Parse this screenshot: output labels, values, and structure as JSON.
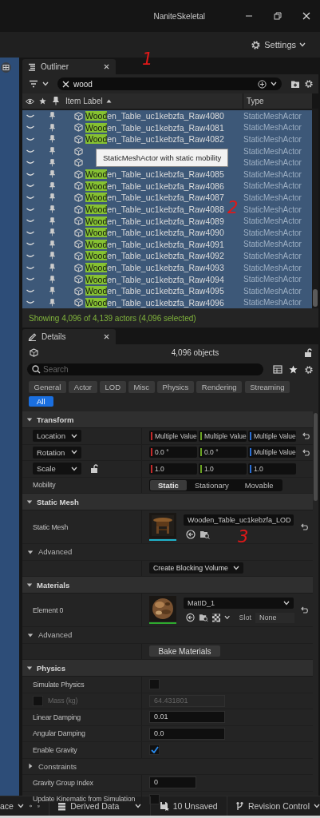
{
  "window": {
    "title": "NaniteSkeletal"
  },
  "toolbar": {
    "settings": "Settings"
  },
  "annotations": [
    "1",
    "2",
    "3"
  ],
  "outliner": {
    "tab": "Outliner",
    "search": {
      "value": "wood"
    },
    "columns": [
      "Item Label",
      "Type"
    ],
    "rows": [
      {
        "label": "**Wood**en_Table_uc1kebzfa_Raw4080",
        "type": "StaticMeshActor",
        "selected": true
      },
      {
        "label": "**Wood**en_Table_uc1kebzfa_Raw4081",
        "type": "StaticMeshActor",
        "selected": true
      },
      {
        "label": "**Wood**en_Table_uc1kebzfa_Raw4082",
        "type": "StaticMeshActor",
        "selected": true
      },
      {
        "type": "StaticMeshActor",
        "selected": true
      },
      {
        "type": "StaticMeshActor",
        "selected": true
      },
      {
        "label": "**Wood**en_Table_uc1kebzfa_Raw4085",
        "type": "StaticMeshActor",
        "selected": true
      },
      {
        "label": "**Wood**en_Table_uc1kebzfa_Raw4086",
        "type": "StaticMeshActor",
        "selected": true
      },
      {
        "label": "**Wood**en_Table_uc1kebzfa_Raw4087",
        "type": "StaticMeshActor",
        "selected": true
      },
      {
        "label": "**Wood**en_Table_uc1kebzfa_Raw4088",
        "type": "StaticMeshActor",
        "selected": true
      },
      {
        "label": "**Wood**en_Table_uc1kebzfa_Raw4089",
        "type": "StaticMeshActor",
        "selected": true
      },
      {
        "label": "**Wood**en_Table_uc1kebzfa_Raw4090",
        "type": "StaticMeshActor",
        "selected": true
      },
      {
        "label": "**Wood**en_Table_uc1kebzfa_Raw4091",
        "type": "StaticMeshActor",
        "selected": true
      },
      {
        "label": "**Wood**en_Table_uc1kebzfa_Raw4092",
        "type": "StaticMeshActor",
        "selected": true
      },
      {
        "label": "**Wood**en_Table_uc1kebzfa_Raw4093",
        "type": "StaticMeshActor",
        "selected": true
      },
      {
        "label": "**Wood**en_Table_uc1kebzfa_Raw4094",
        "type": "StaticMeshActor",
        "selected": true
      },
      {
        "label": "**Wood**en_Table_uc1kebzfa_Raw4095",
        "type": "StaticMeshActor",
        "selected": true
      },
      {
        "label": "**Wood**en_Table_uc1kebzfa_Raw4096",
        "type": "StaticMeshActor",
        "selected": true
      }
    ],
    "tooltip": "StaticMeshActor with static mobility",
    "status": "Showing 4,096 of 4,139 actors (4,096 selected)"
  },
  "details": {
    "tab": "Details",
    "objects": "4,096 objects",
    "search": {
      "placeholder": "Search"
    },
    "filters": [
      {
        "label": "General",
        "selected": false
      },
      {
        "label": "Actor",
        "selected": false
      },
      {
        "label": "LOD",
        "selected": false
      },
      {
        "label": "Misc",
        "selected": false
      },
      {
        "label": "Physics",
        "selected": false
      },
      {
        "label": "Rendering",
        "selected": false
      },
      {
        "label": "Streaming",
        "selected": false
      },
      {
        "label": "All",
        "selected": true
      }
    ],
    "sections": [
      {
        "title": "Transform",
        "expanded": true,
        "rows": [
          {
            "kind": "vector",
            "label": "Location",
            "values": [
              "Multiple Value",
              "Multiple Value",
              "Multiple Value"
            ],
            "reset": true
          },
          {
            "kind": "vector",
            "label": "Rotation",
            "values": [
              "0.0 °",
              "0.0 °",
              "Multiple Value"
            ],
            "reset": true
          },
          {
            "kind": "vector",
            "label": "Scale",
            "values": [
              "1.0",
              "1.0",
              "1.0"
            ],
            "locked": false,
            "reset": false
          },
          {
            "kind": "segmented",
            "label": "Mobility",
            "options": [
              {
                "label": "Static",
                "selected": true
              },
              {
                "label": "Stationary",
                "selected": false
              },
              {
                "label": "Movable",
                "selected": false
              }
            ]
          }
        ]
      },
      {
        "title": "Static Mesh",
        "expanded": true,
        "rows": [
          {
            "kind": "asset",
            "label": "Static Mesh",
            "value": "Wooden_Table_uc1kebzfa_LOD",
            "color": "#1fb4cc",
            "reset": true
          },
          {
            "kind": "subheader",
            "label": "Advanced",
            "expanded": true
          },
          {
            "kind": "action",
            "value": "Create Blocking Volume",
            "dropdown": true
          }
        ]
      },
      {
        "title": "Materials",
        "expanded": true,
        "rows": [
          {
            "kind": "material",
            "label": "Element 0",
            "value": "MatID_1",
            "color": "#2eaa2e",
            "slot_label": "Slot",
            "slot_value": "None",
            "reset": true
          },
          {
            "kind": "subheader",
            "label": "Advanced",
            "expanded": true
          },
          {
            "kind": "action",
            "value": "Bake Materials",
            "dropdown": false
          }
        ]
      },
      {
        "title": "Physics",
        "expanded": true,
        "rows": [
          {
            "kind": "checkbox",
            "label": "Simulate Physics",
            "checked": false
          },
          {
            "kind": "number",
            "label": "Mass (kg)",
            "value": "64.431801",
            "disabled": true,
            "checked": false
          },
          {
            "kind": "number",
            "label": "Linear Damping",
            "value": "0.01",
            "disabled": false
          },
          {
            "kind": "number",
            "label": "Angular Damping",
            "value": "0.0",
            "disabled": false
          },
          {
            "kind": "checkbox",
            "label": "Enable Gravity",
            "checked": true
          },
          {
            "kind": "group",
            "label": "Constraints",
            "expanded": false
          },
          {
            "kind": "integer",
            "label": "Gravity Group Index",
            "value": "0",
            "disabled": false
          },
          {
            "kind": "checkbox",
            "label": "Update Kinematic from Simulation",
            "checked": false
          }
        ]
      }
    ]
  },
  "status_bar": {
    "workspace": "ace",
    "derived_data": "Derived Data",
    "unsaved": "10 Unsaved",
    "revision_control": "Revision Control"
  }
}
